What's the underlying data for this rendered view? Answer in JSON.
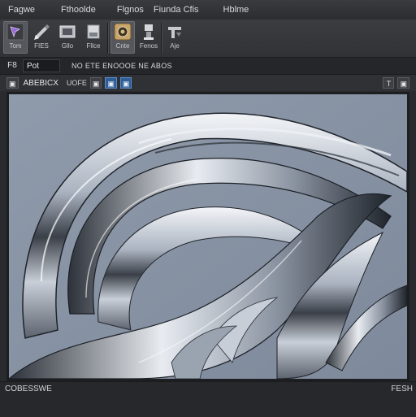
{
  "menu": {
    "file": "Fagwe",
    "edit": "Fthoolde",
    "image": "Flgnos",
    "window": "Fiunda Cfis",
    "help": "Hblme"
  },
  "ribbon": {
    "tools": [
      {
        "icon": "selection-arrow-icon",
        "label": "Tom"
      },
      {
        "icon": "pen-tool-icon",
        "label": "FIES"
      },
      {
        "icon": "crop-icon",
        "label": "Gllo"
      },
      {
        "icon": "shape-icon",
        "label": "Fllce"
      },
      {
        "icon": "brush-palette-icon",
        "label": "Cnte"
      },
      {
        "icon": "adjust-icon",
        "label": "Fenos"
      },
      {
        "icon": "transform-icon",
        "label": "Aje"
      }
    ]
  },
  "propbar": {
    "icon_label": "F8",
    "field_value": "Pot",
    "caption": "NO ETE ENOOOE NE ABOS"
  },
  "doctoolbar": {
    "menu_btn": "▣",
    "doc_name": "ABEBICX",
    "zoom": "UOFE",
    "btn_a": "▣",
    "btn_b": "▣",
    "btn_c": "▣",
    "right_btn_a": "T",
    "right_btn_b": "▣"
  },
  "status": {
    "left": "COBESSWE",
    "right": "FESH"
  },
  "colors": {
    "accent": "#2f5d95",
    "canvas_bg": "#8d98a8",
    "app_bg": "#2a2b2e"
  }
}
